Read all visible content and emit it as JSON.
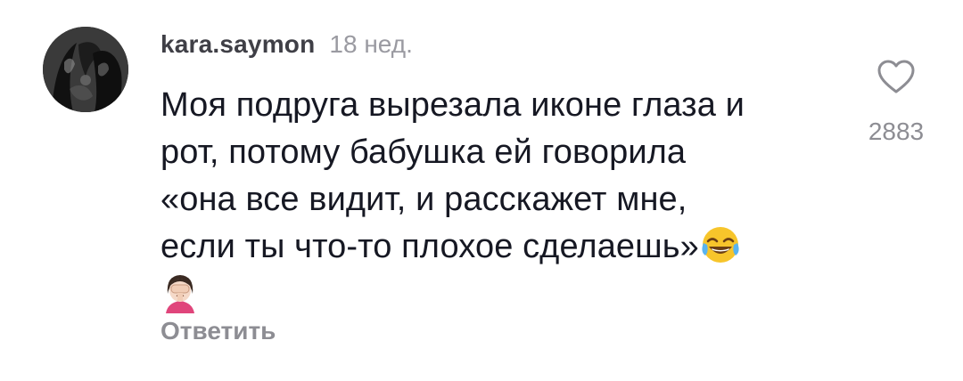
{
  "comment": {
    "username": "kara.saymon",
    "timestamp": "18 нед.",
    "text_lines": [
      "Моя подруга вырезала иконе глаза и",
      "рот, потому бабушка ей говорила",
      "«она все видит, и расскажет мне,",
      "если ты что-то плохое сделаешь»"
    ],
    "emojis": [
      "face-with-tears-of-joy",
      "woman-facepalming"
    ],
    "reply_label": "Ответить",
    "like_count": "2883",
    "like_icon": "heart-outline-icon"
  },
  "colors": {
    "username": "#3f3f46",
    "timestamp": "#9a9aa1",
    "body": "#161823",
    "muted": "#8d8d93",
    "background": "#ffffff"
  }
}
